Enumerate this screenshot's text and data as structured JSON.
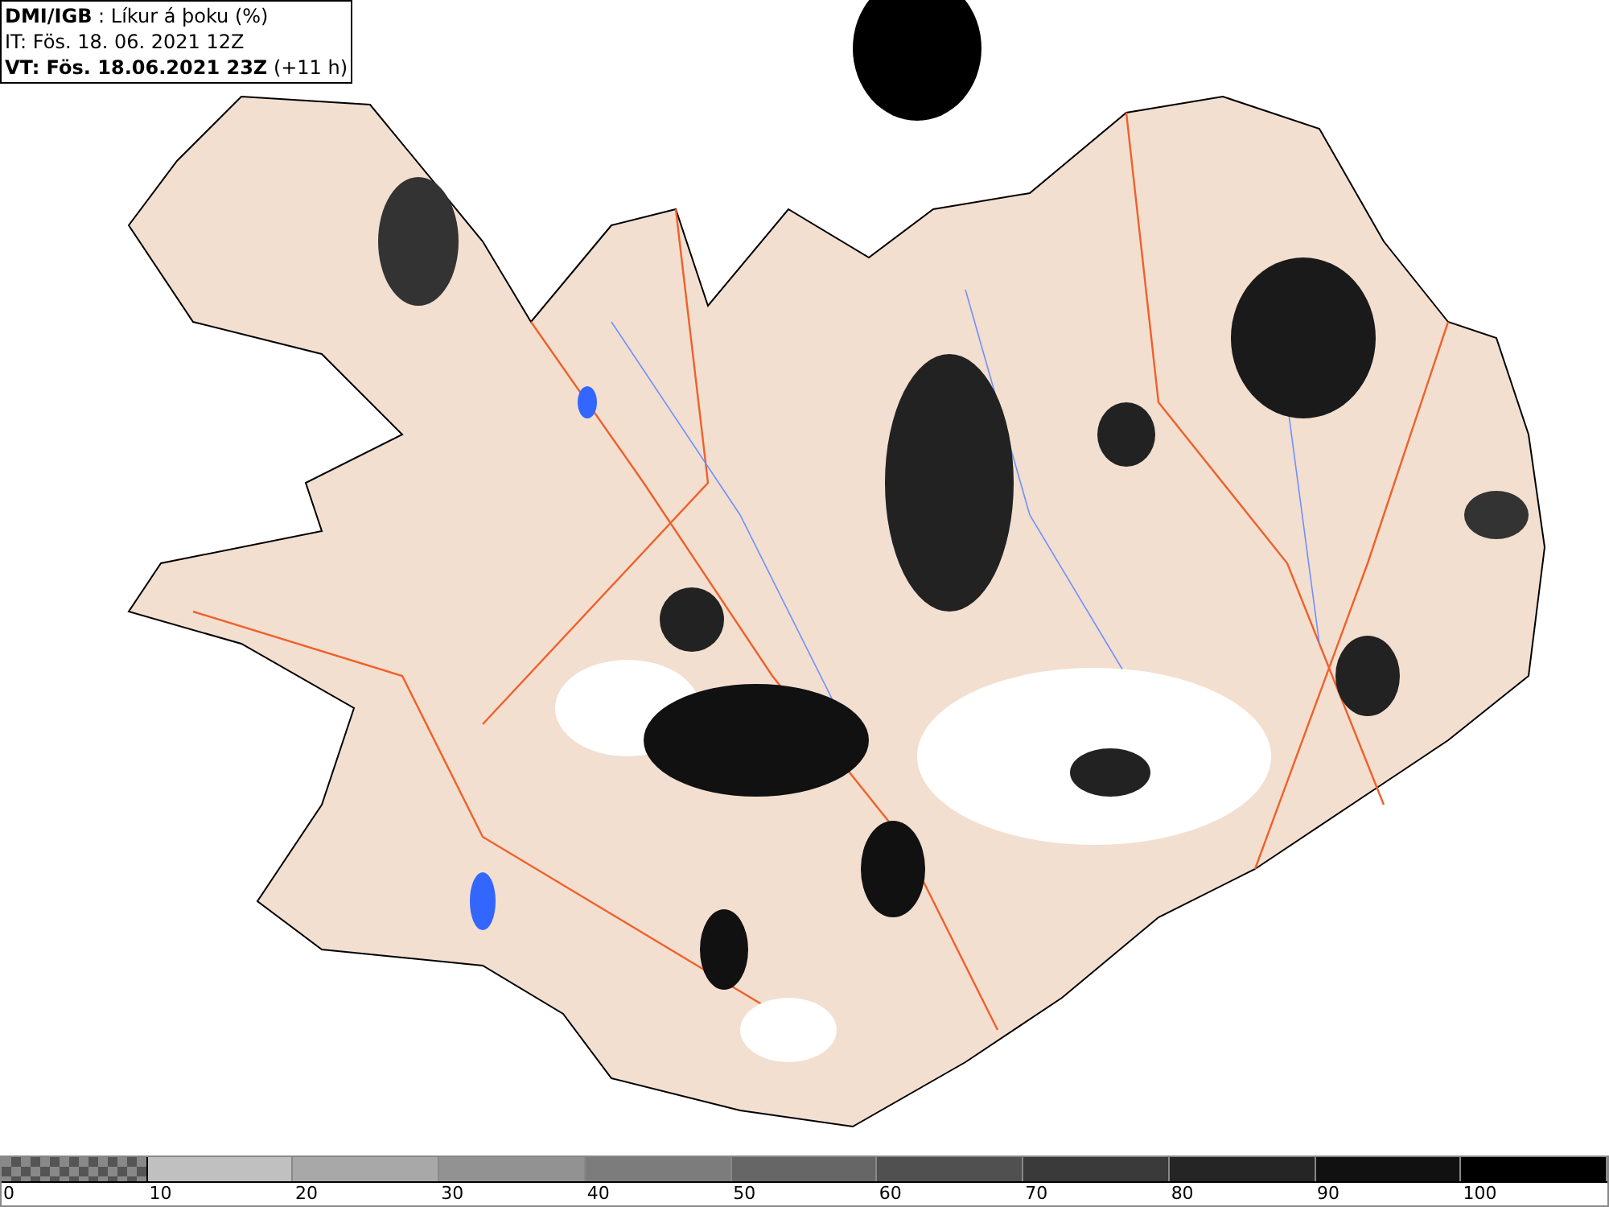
{
  "header": {
    "lines": [
      "**DMI/IGB** : Líkur á þoku (%)",
      "IT: Fös. 18. 06. 2021 12Z",
      "**VT: Fös. 18.06.2021 23Z** (+11 h)"
    ]
  },
  "legend": [
    {
      "label": "0",
      "kind": "checker"
    },
    {
      "label": "10",
      "kind": "solid",
      "color": "#c0c0c0"
    },
    {
      "label": "20",
      "kind": "solid",
      "color": "#a8a8a8"
    },
    {
      "label": "30",
      "kind": "solid",
      "color": "#929292"
    },
    {
      "label": "40",
      "kind": "solid",
      "color": "#7c7c7c"
    },
    {
      "label": "50",
      "kind": "solid",
      "color": "#666666"
    },
    {
      "label": "60",
      "kind": "solid",
      "color": "#505050"
    },
    {
      "label": "70",
      "kind": "solid",
      "color": "#3a3a3a"
    },
    {
      "label": "80",
      "kind": "solid",
      "color": "#252525"
    },
    {
      "label": "90",
      "kind": "solid",
      "color": "#111111"
    },
    {
      "label": "100",
      "kind": "solid",
      "color": "#000000"
    }
  ]
}
